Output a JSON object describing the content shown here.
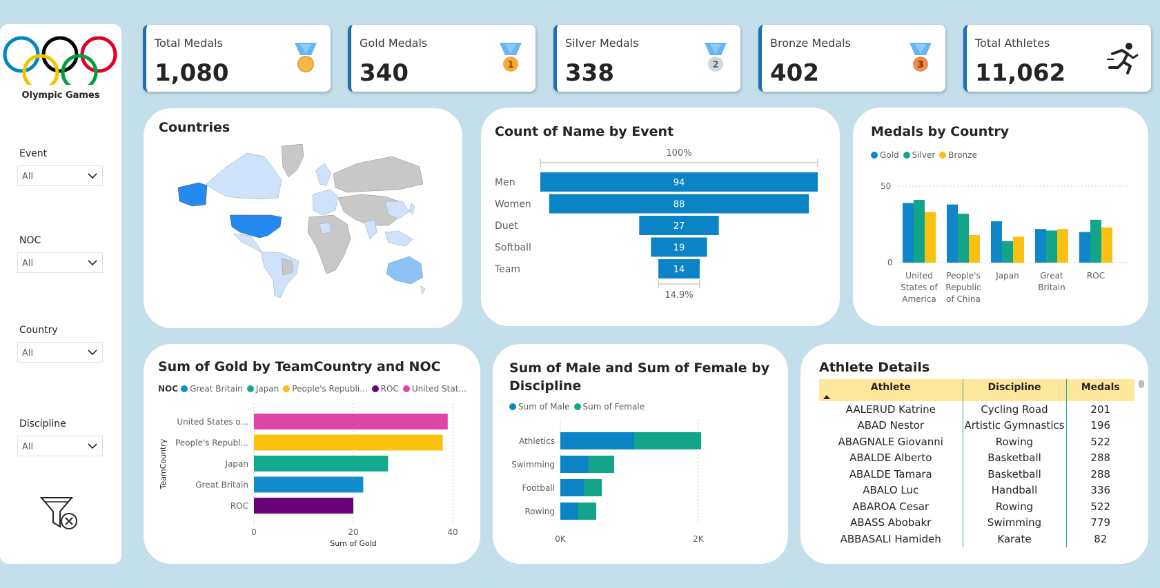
{
  "sidebar": {
    "logo_caption": "Olympic Games",
    "slicers": [
      {
        "label": "Event",
        "value": "All"
      },
      {
        "label": "NOC",
        "value": "All"
      },
      {
        "label": "Country",
        "value": "All"
      },
      {
        "label": "Discipline",
        "value": "All"
      }
    ]
  },
  "kpis": [
    {
      "label": "Total Medals",
      "value": "1,080",
      "icon": "medal-gold-icon"
    },
    {
      "label": "Gold Medals",
      "value": "340",
      "icon": "medal-1-icon",
      "badge": "1"
    },
    {
      "label": "Silver Medals",
      "value": "338",
      "icon": "medal-2-icon",
      "badge": "2"
    },
    {
      "label": "Bronze Medals",
      "value": "402",
      "icon": "medal-3-icon",
      "badge": "3"
    },
    {
      "label": "Total Athletes",
      "value": "11,062",
      "icon": "runner-icon"
    }
  ],
  "colors": {
    "gold": "#0f86c7",
    "silver": "#13a58a",
    "bronze": "#f9c113",
    "funnel": "#0b84c6",
    "usa": "#e044a7",
    "china": "#fcc00e",
    "japan": "#12ab8f",
    "gb": "#118dcf",
    "roc": "#6b007b"
  },
  "countries": {
    "title": "Countries"
  },
  "funnel": {
    "title": "Count of Name by Event",
    "top_pct": "100%",
    "bottom_pct": "14.9%",
    "chart_data": {
      "type": "bar",
      "categories": [
        "Men",
        "Women",
        "Duet",
        "Softball",
        "Team"
      ],
      "values": [
        94,
        88,
        27,
        19,
        14
      ]
    }
  },
  "medals_by_country": {
    "title": "Medals by Country",
    "legend": [
      "Gold",
      "Silver",
      "Bronze"
    ],
    "chart_data": {
      "type": "bar",
      "categories": [
        [
          "United",
          "States of",
          "America"
        ],
        [
          "People's",
          "Republic",
          "of China"
        ],
        [
          "Japan"
        ],
        [
          "Great",
          "Britain"
        ],
        [
          "ROC"
        ]
      ],
      "series": [
        {
          "name": "Gold",
          "values": [
            39,
            38,
            27,
            22,
            20
          ]
        },
        {
          "name": "Silver",
          "values": [
            41,
            32,
            14,
            21,
            28
          ]
        },
        {
          "name": "Bronze",
          "values": [
            33,
            18,
            17,
            22,
            23
          ]
        }
      ],
      "ylim": [
        0,
        50
      ],
      "yticks": [
        "0",
        "50"
      ]
    }
  },
  "gold_by_team": {
    "title": "Sum of Gold by TeamCountry and NOC",
    "legend_title": "NOC",
    "legend": [
      "Great Britain",
      "Japan",
      "People's Republi...",
      "ROC",
      "United Stat..."
    ],
    "xlabel": "Sum of Gold",
    "ylabel": "TeamCountry",
    "chart_data": {
      "type": "bar",
      "categories": [
        "United States o...",
        "People's Republ...",
        "Japan",
        "Great Britain",
        "ROC"
      ],
      "values": [
        39,
        38,
        27,
        22,
        20
      ],
      "xlim": [
        0,
        40
      ],
      "xticks": [
        "0",
        "20",
        "40"
      ]
    }
  },
  "male_female": {
    "title_line1": "Sum of Male and Sum of Female by",
    "title_line2": "Discipline",
    "legend": [
      "Sum of Male",
      "Sum of Female"
    ],
    "chart_data": {
      "type": "bar",
      "categories": [
        "Athletics",
        "Swimming",
        "Football",
        "Rowing"
      ],
      "series": [
        {
          "name": "Sum of Male",
          "values": [
            1070,
            410,
            340,
            260
          ]
        },
        {
          "name": "Sum of Female",
          "values": [
            970,
            370,
            260,
            260
          ]
        }
      ],
      "xlim": [
        0,
        2000
      ],
      "xticks": [
        "0K",
        "2K"
      ]
    }
  },
  "athletes": {
    "title": "Athlete Details",
    "columns": [
      "Athlete",
      "Discipline",
      "Medals"
    ],
    "rows": [
      [
        "AALERUD Katrine",
        "Cycling Road",
        "201"
      ],
      [
        "ABAD Nestor",
        "Artistic Gymnastics",
        "196"
      ],
      [
        "ABAGNALE Giovanni",
        "Rowing",
        "522"
      ],
      [
        "ABALDE Alberto",
        "Basketball",
        "288"
      ],
      [
        "ABALDE Tamara",
        "Basketball",
        "288"
      ],
      [
        "ABALO Luc",
        "Handball",
        "336"
      ],
      [
        "ABAROA Cesar",
        "Rowing",
        "522"
      ],
      [
        "ABASS Abobakr",
        "Swimming",
        "779"
      ],
      [
        "ABBASALI Hamideh",
        "Karate",
        "82"
      ]
    ]
  }
}
